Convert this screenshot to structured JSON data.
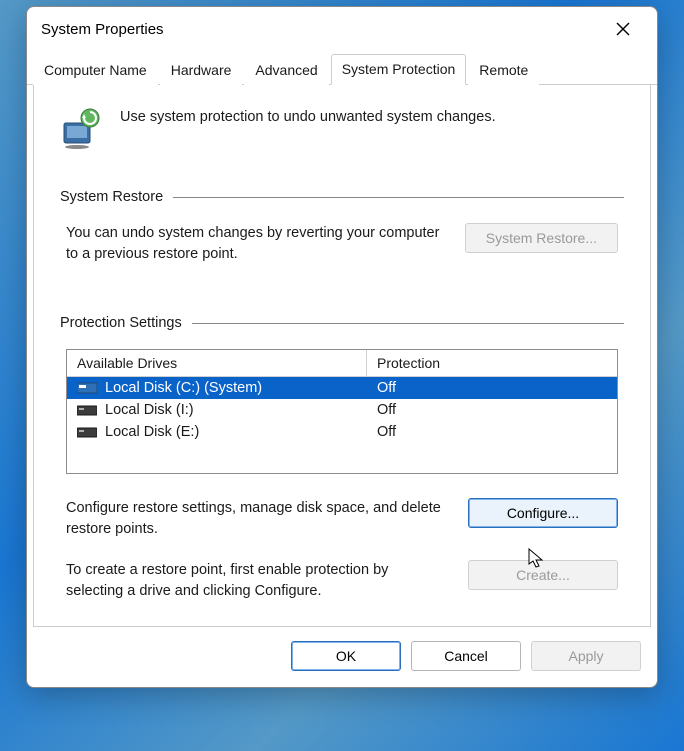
{
  "title": "System Properties",
  "tabs": [
    {
      "label": "Computer Name",
      "active": false
    },
    {
      "label": "Hardware",
      "active": false
    },
    {
      "label": "Advanced",
      "active": false
    },
    {
      "label": "System Protection",
      "active": true
    },
    {
      "label": "Remote",
      "active": false
    }
  ],
  "intro_text": "Use system protection to undo unwanted system changes.",
  "restore_group": {
    "title": "System Restore",
    "text": "You can undo system changes by reverting your computer to a previous restore point.",
    "button": "System Restore...",
    "button_enabled": false
  },
  "protection_group": {
    "title": "Protection Settings",
    "columns": {
      "drives": "Available Drives",
      "protection": "Protection"
    },
    "rows": [
      {
        "label": "Local Disk (C:) (System)",
        "protection": "Off",
        "selected": true,
        "icon": "drive-system"
      },
      {
        "label": "Local Disk (I:)",
        "protection": "Off",
        "selected": false,
        "icon": "drive"
      },
      {
        "label": "Local Disk (E:)",
        "protection": "Off",
        "selected": false,
        "icon": "drive"
      }
    ],
    "configure": {
      "text": "Configure restore settings, manage disk space, and delete restore points.",
      "button": "Configure...",
      "button_focused": true
    },
    "create": {
      "text": "To create a restore point, first enable protection by selecting a drive and clicking Configure.",
      "button": "Create...",
      "button_enabled": false
    }
  },
  "footer": {
    "ok": "OK",
    "cancel": "Cancel",
    "apply": "Apply",
    "apply_enabled": false
  }
}
